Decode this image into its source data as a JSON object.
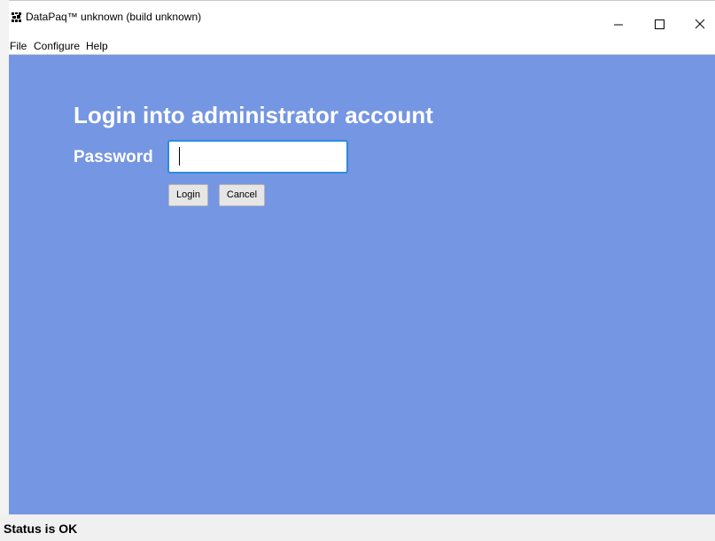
{
  "window": {
    "title": "DataPaq™ unknown (build unknown)",
    "icon": "datapaq-logo-icon",
    "controls": [
      "minimize-icon",
      "maximize-icon",
      "close-icon"
    ]
  },
  "menu": {
    "items": [
      "File",
      "Configure",
      "Help"
    ]
  },
  "login": {
    "title": "Login into administrator account",
    "password_label": "Password",
    "password_value": "",
    "login_label": "Login",
    "cancel_label": "Cancel"
  },
  "status": {
    "text": "Status is OK"
  },
  "colors": {
    "content_background": "#7596e2",
    "heading_text": "#ffffff",
    "input_focus_border": "#2c8be0"
  }
}
